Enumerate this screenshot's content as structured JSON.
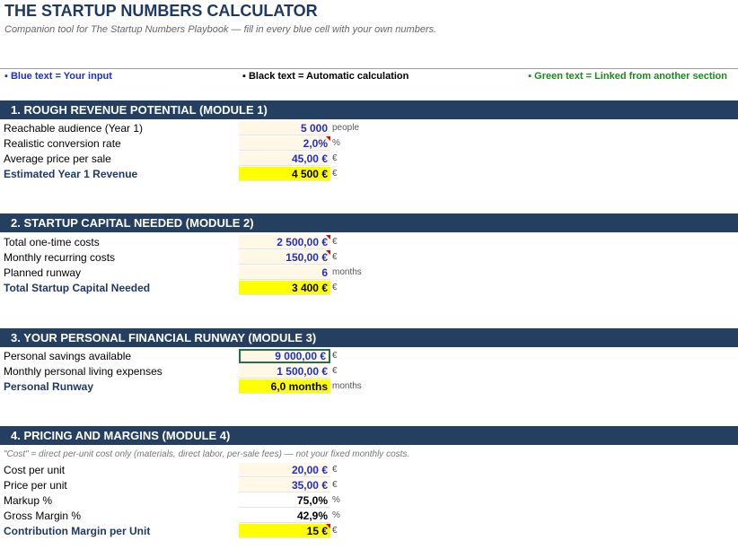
{
  "header": {
    "title": "THE STARTUP NUMBERS CALCULATOR",
    "subtitle": "Companion tool for The Startup Numbers Playbook — fill in every blue cell with your own numbers."
  },
  "legend": {
    "blue": "▪ Blue text = Your input",
    "black": "▪ Black text = Automatic calculation",
    "green": "▪ Green text = Linked from another section"
  },
  "sections": [
    {
      "title": "1.  ROUGH REVENUE POTENTIAL  (MODULE 1)",
      "rows": [
        {
          "label": "Reachable audience (Year 1)",
          "value": "5 000",
          "unit": "people"
        },
        {
          "label": "Realistic conversion rate",
          "value": "2,0%",
          "unit": "%"
        },
        {
          "label": "Average price per sale",
          "value": "45,00 €",
          "unit": "€"
        },
        {
          "label": "Estimated Year 1 Revenue",
          "value": "4 500 €",
          "unit": "€"
        }
      ]
    },
    {
      "title": "2.  STARTUP CAPITAL NEEDED  (MODULE 2)",
      "rows": [
        {
          "label": "Total one-time costs",
          "value": "2 500,00 €",
          "unit": "€"
        },
        {
          "label": "Monthly recurring costs",
          "value": "150,00 €",
          "unit": "€"
        },
        {
          "label": "Planned runway",
          "value": "6",
          "unit": "months"
        },
        {
          "label": "Total Startup Capital Needed",
          "value": "3 400 €",
          "unit": "€"
        }
      ]
    },
    {
      "title": "3.  YOUR PERSONAL FINANCIAL RUNWAY  (MODULE 3)",
      "rows": [
        {
          "label": "Personal savings available",
          "value": "9 000,00 €",
          "unit": "€"
        },
        {
          "label": "Monthly personal living expenses",
          "value": "1 500,00 €",
          "unit": "€"
        },
        {
          "label": "Personal Runway",
          "value": "6,0 months",
          "unit": "months"
        }
      ]
    },
    {
      "title": "4.  PRICING AND MARGINS  (MODULE 4)",
      "note": "\"Cost\" = direct per-unit cost only (materials, direct labor, per-sale fees) — not your fixed monthly costs.",
      "rows": [
        {
          "label": "Cost per unit",
          "value": "20,00 €",
          "unit": "€"
        },
        {
          "label": "Price per unit",
          "value": "35,00 €",
          "unit": "€"
        },
        {
          "label": "Markup %",
          "value": "75,0%",
          "unit": "%"
        },
        {
          "label": "Gross Margin %",
          "value": "42,9%",
          "unit": "%"
        },
        {
          "label": "Contribution Margin per Unit",
          "value": "15 €",
          "unit": "€"
        }
      ]
    }
  ],
  "colors": {
    "header_band": "#243f60",
    "input_text": "#1f2fc8",
    "linked_text": "#1a8a1a",
    "total_fill": "#ffff00",
    "input_fill": "#fff8e6",
    "selection_border": "#217346",
    "comment_marker": "#e00000"
  }
}
